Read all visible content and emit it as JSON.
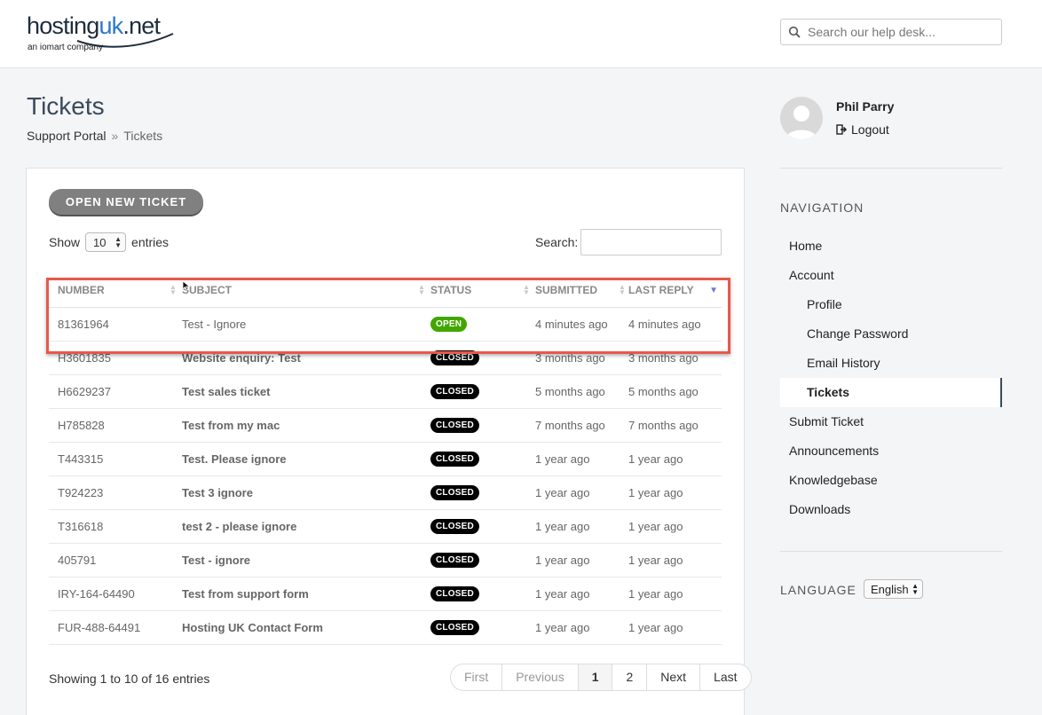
{
  "header": {
    "logo_main_a": "hosting",
    "logo_main_b": "uk",
    "logo_main_c": ".net",
    "logo_sub": "an iomart company",
    "search_placeholder": "Search our help desk..."
  },
  "page": {
    "title": "Tickets",
    "breadcrumb": [
      "Support Portal",
      "»",
      "Tickets"
    ]
  },
  "toolbar": {
    "open_ticket_label": "OPEN NEW TICKET",
    "show_label": "Show",
    "entries_label": "entries",
    "page_size": "10",
    "search_label": "Search:"
  },
  "table": {
    "columns": [
      "NUMBER",
      "SUBJECT",
      "STATUS",
      "SUBMITTED",
      "LAST REPLY"
    ],
    "rows": [
      {
        "number": "81361964",
        "subject": "Test - Ignore",
        "status": "OPEN",
        "submitted": "4 minutes ago",
        "last_reply": "4 minutes ago"
      },
      {
        "number": "H3601835",
        "subject": "Website enquiry: Test",
        "status": "CLOSED",
        "submitted": "3 months ago",
        "last_reply": "3 months ago"
      },
      {
        "number": "H6629237",
        "subject": "Test sales ticket",
        "status": "CLOSED",
        "submitted": "5 months ago",
        "last_reply": "5 months ago"
      },
      {
        "number": "H785828",
        "subject": "Test from my mac",
        "status": "CLOSED",
        "submitted": "7 months ago",
        "last_reply": "7 months ago"
      },
      {
        "number": "T443315",
        "subject": "Test. Please ignore",
        "status": "CLOSED",
        "submitted": "1 year ago",
        "last_reply": "1 year ago"
      },
      {
        "number": "T924223",
        "subject": "Test 3 ignore",
        "status": "CLOSED",
        "submitted": "1 year ago",
        "last_reply": "1 year ago"
      },
      {
        "number": "T316618",
        "subject": "test 2 - please ignore",
        "status": "CLOSED",
        "submitted": "1 year ago",
        "last_reply": "1 year ago"
      },
      {
        "number": "405791",
        "subject": "Test - ignore",
        "status": "CLOSED",
        "submitted": "1 year ago",
        "last_reply": "1 year ago"
      },
      {
        "number": "IRY-164-64490",
        "subject": "Test from support form",
        "status": "CLOSED",
        "submitted": "1 year ago",
        "last_reply": "1 year ago"
      },
      {
        "number": "FUR-488-64491",
        "subject": "Hosting UK Contact Form",
        "status": "CLOSED",
        "submitted": "1 year ago",
        "last_reply": "1 year ago"
      }
    ],
    "showing_text": "Showing 1 to 10 of 16 entries"
  },
  "pagination": [
    "First",
    "Previous",
    "1",
    "2",
    "Next",
    "Last"
  ],
  "user": {
    "name": "Phil Parry",
    "logout_label": "Logout"
  },
  "navigation": {
    "heading": "NAVIGATION",
    "items": [
      {
        "label": "Home"
      },
      {
        "label": "Account"
      },
      {
        "label": "Profile"
      },
      {
        "label": "Change Password"
      },
      {
        "label": "Email History"
      },
      {
        "label": "Tickets"
      },
      {
        "label": "Submit Ticket"
      },
      {
        "label": "Announcements"
      },
      {
        "label": "Knowledgebase"
      },
      {
        "label": "Downloads"
      }
    ]
  },
  "language": {
    "heading": "LANGUAGE",
    "selected": "English"
  },
  "colors": {
    "open_badge": "#41a700",
    "closed_badge": "#000000",
    "highlight": "#e8584b",
    "title": "#3a4a5c"
  }
}
